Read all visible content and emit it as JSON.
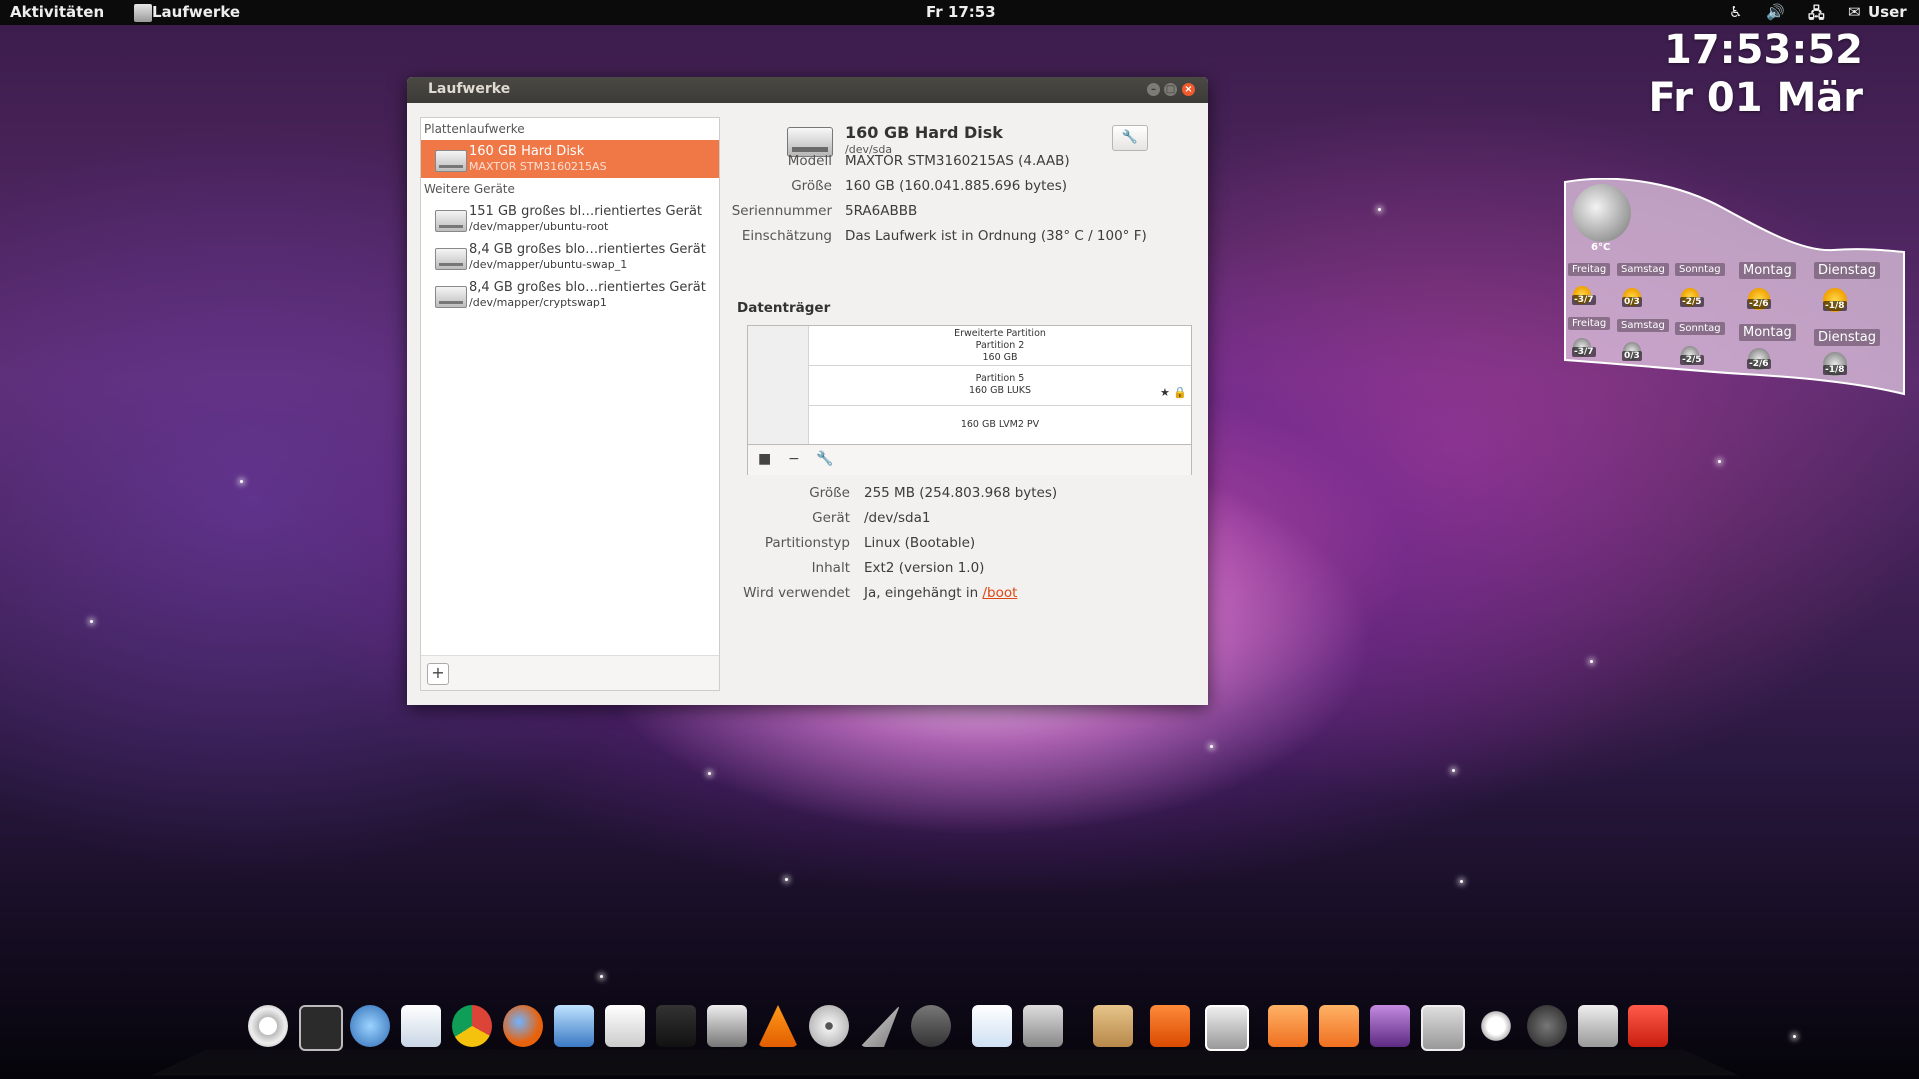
{
  "topbar": {
    "activities": "Aktivitäten",
    "app": "Laufwerke",
    "clock": "Fr 17:53",
    "user": "User"
  },
  "desktop_clock": {
    "time": "17:53:52",
    "date": "Fr 01 Mär"
  },
  "weather": {
    "current_temp": "6°C",
    "row1": [
      {
        "day": "Freitag",
        "value": "-3/7",
        "icon": "sun-icon"
      },
      {
        "day": "Samstag",
        "value": "0/3",
        "icon": "sun-icon"
      },
      {
        "day": "Sonntag",
        "value": "-2/5",
        "icon": "sun-icon"
      },
      {
        "day": "Montag",
        "value": "-2/6",
        "icon": "sun-icon"
      },
      {
        "day": "Dienstag",
        "value": "-1/8",
        "icon": "sun-icon"
      }
    ],
    "row2": [
      {
        "day": "Freitag",
        "value": "-3/7",
        "icon": "moon-icon"
      },
      {
        "day": "Samstag",
        "value": "0/3",
        "icon": "moon-icon"
      },
      {
        "day": "Sonntag",
        "value": "-2/5",
        "icon": "moon-icon"
      },
      {
        "day": "Montag",
        "value": "-2/6",
        "icon": "moon-icon"
      },
      {
        "day": "Dienstag",
        "value": "-1/8",
        "icon": "moon-icon"
      }
    ]
  },
  "window": {
    "title": "Laufwerke",
    "sidebar": {
      "section1": "Plattenlaufwerke",
      "section2": "Weitere Geräte",
      "drives": [
        {
          "name": "160 GB Hard Disk",
          "sub": "MAXTOR STM3160215AS"
        }
      ],
      "devices": [
        {
          "name": "151 GB großes bl…rientiertes Gerät",
          "sub": "/dev/mapper/ubuntu-root"
        },
        {
          "name": "8,4 GB großes blo…rientiertes Gerät",
          "sub": "/dev/mapper/ubuntu-swap_1"
        },
        {
          "name": "8,4 GB großes blo…rientiertes Gerät",
          "sub": "/dev/mapper/cryptswap1"
        }
      ],
      "add_label": "+"
    },
    "disk": {
      "title": "160 GB Hard Disk",
      "device": "/dev/sda",
      "props": [
        {
          "k": "Modell",
          "v": "MAXTOR STM3160215AS (4.AAB)"
        },
        {
          "k": "Größe",
          "v": "160 GB (160.041.885.696 bytes)"
        },
        {
          "k": "Seriennummer",
          "v": "5RA6ABBB"
        },
        {
          "k": "Einschätzung",
          "v": "Das Laufwerk ist in Ordnung (38° C / 100° F)"
        }
      ]
    },
    "volumes_heading": "Datenträger",
    "partitions": {
      "row1": [
        "Erweiterte Partition",
        "Partition 2",
        "160 GB"
      ],
      "row2": [
        "Partition 5",
        "160 GB LUKS"
      ],
      "row3": "160 GB LVM2 PV",
      "row2_flags": "★ 🔒"
    },
    "partition_props": [
      {
        "k": "Größe",
        "v": "255 MB (254.803.968 bytes)"
      },
      {
        "k": "Gerät",
        "v": "/dev/sda1"
      },
      {
        "k": "Partitionstyp",
        "v": "Linux (Bootable)"
      },
      {
        "k": "Inhalt",
        "v": "Ext2 (version 1.0)"
      }
    ],
    "used": {
      "k": "Wird verwendet",
      "prefix": "Ja, eingehängt in ",
      "link": "/boot"
    }
  }
}
